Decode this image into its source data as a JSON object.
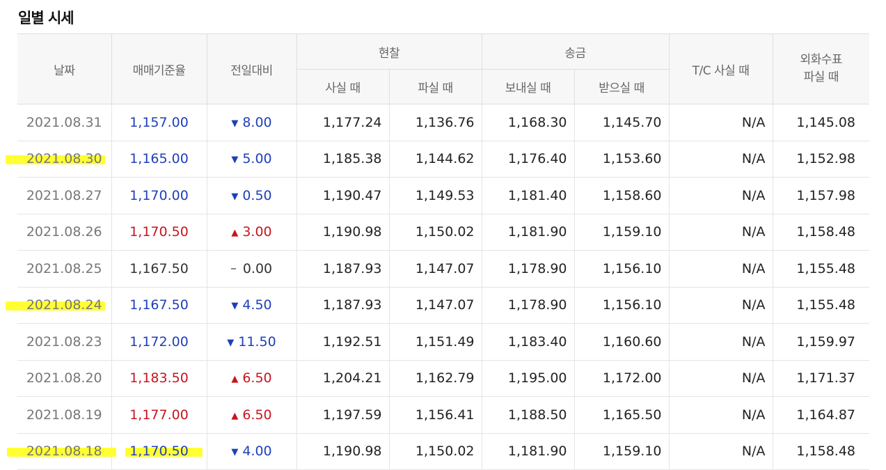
{
  "title": "일별 시세",
  "headers": {
    "date": "날짜",
    "base_rate": "매매기준율",
    "change": "전일대비",
    "cash": "현찰",
    "cash_buy": "사실 때",
    "cash_sell": "파실 때",
    "remit": "송금",
    "remit_send": "보내실 때",
    "remit_receive": "받으실 때",
    "tc_buy": "T/C 사실 때",
    "check_sell_line1": "외화수표",
    "check_sell_line2": "파실 때"
  },
  "colors": {
    "down": "#1e3fb9",
    "up": "#c8141e",
    "flat": "#333333",
    "highlight": "#ffff33"
  },
  "rows": [
    {
      "date": "2021.08.31",
      "rate": "1,157.00",
      "dir": "down",
      "change": "8.00",
      "cash_buy": "1,177.24",
      "cash_sell": "1,136.76",
      "send": "1,168.30",
      "receive": "1,145.70",
      "tc": "N/A",
      "check": "1,145.08"
    },
    {
      "date": "2021.08.30",
      "rate": "1,165.00",
      "dir": "down",
      "change": "5.00",
      "cash_buy": "1,185.38",
      "cash_sell": "1,144.62",
      "send": "1,176.40",
      "receive": "1,153.60",
      "tc": "N/A",
      "check": "1,152.98"
    },
    {
      "date": "2021.08.27",
      "rate": "1,170.00",
      "dir": "down",
      "change": "0.50",
      "cash_buy": "1,190.47",
      "cash_sell": "1,149.53",
      "send": "1,181.40",
      "receive": "1,158.60",
      "tc": "N/A",
      "check": "1,157.98"
    },
    {
      "date": "2021.08.26",
      "rate": "1,170.50",
      "dir": "up",
      "change": "3.00",
      "cash_buy": "1,190.98",
      "cash_sell": "1,150.02",
      "send": "1,181.90",
      "receive": "1,159.10",
      "tc": "N/A",
      "check": "1,158.48"
    },
    {
      "date": "2021.08.25",
      "rate": "1,167.50",
      "dir": "flat",
      "change": "0.00",
      "cash_buy": "1,187.93",
      "cash_sell": "1,147.07",
      "send": "1,178.90",
      "receive": "1,156.10",
      "tc": "N/A",
      "check": "1,155.48"
    },
    {
      "date": "2021.08.24",
      "rate": "1,167.50",
      "dir": "down",
      "change": "4.50",
      "cash_buy": "1,187.93",
      "cash_sell": "1,147.07",
      "send": "1,178.90",
      "receive": "1,156.10",
      "tc": "N/A",
      "check": "1,155.48"
    },
    {
      "date": "2021.08.23",
      "rate": "1,172.00",
      "dir": "down",
      "change": "11.50",
      "cash_buy": "1,192.51",
      "cash_sell": "1,151.49",
      "send": "1,183.40",
      "receive": "1,160.60",
      "tc": "N/A",
      "check": "1,159.97"
    },
    {
      "date": "2021.08.20",
      "rate": "1,183.50",
      "dir": "up",
      "change": "6.50",
      "cash_buy": "1,204.21",
      "cash_sell": "1,162.79",
      "send": "1,195.00",
      "receive": "1,172.00",
      "tc": "N/A",
      "check": "1,171.37"
    },
    {
      "date": "2021.08.19",
      "rate": "1,177.00",
      "dir": "up",
      "change": "6.50",
      "cash_buy": "1,197.59",
      "cash_sell": "1,156.41",
      "send": "1,188.50",
      "receive": "1,165.50",
      "tc": "N/A",
      "check": "1,164.87"
    },
    {
      "date": "2021.08.18",
      "rate": "1,170.50",
      "dir": "down",
      "change": "4.00",
      "cash_buy": "1,190.98",
      "cash_sell": "1,150.02",
      "send": "1,181.90",
      "receive": "1,159.10",
      "tc": "N/A",
      "check": "1,158.48"
    }
  ],
  "highlights": [
    {
      "row": 1,
      "date": true,
      "rate": false
    },
    {
      "row": 5,
      "date": true,
      "rate": false
    },
    {
      "row": 9,
      "date": true,
      "rate": true
    }
  ]
}
